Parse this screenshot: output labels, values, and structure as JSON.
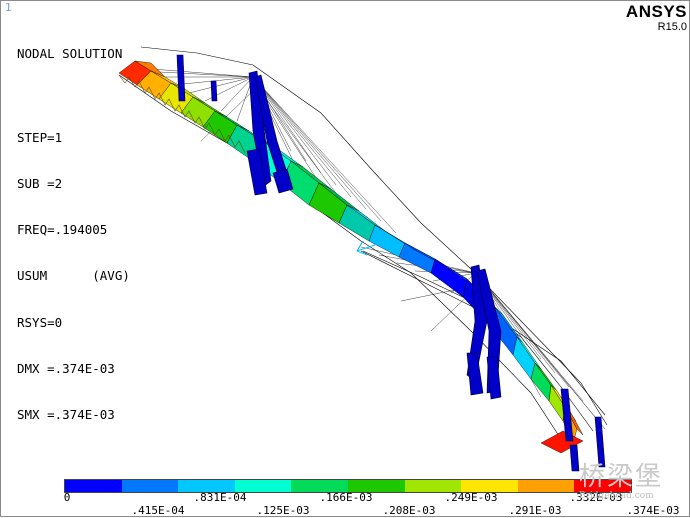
{
  "window": {
    "number": "1"
  },
  "solution_info": {
    "title": "NODAL SOLUTION",
    "lines": [
      "STEP=1",
      "SUB =2",
      "FREQ=.194005",
      "USUM      (AVG)",
      "RSYS=0",
      "DMX =.374E-03",
      "SMX =.374E-03"
    ]
  },
  "logo": {
    "name": "ANSYS",
    "version": "R15.0"
  },
  "legend": {
    "colors": [
      "#0000ff",
      "#0078ff",
      "#00c8ff",
      "#00ffd2",
      "#00dc5a",
      "#1ec800",
      "#a0e600",
      "#ffe600",
      "#ffa000",
      "#ff0000"
    ],
    "top_labels": [
      "0",
      ".831E-04",
      ".166E-03",
      ".249E-03",
      ".332E-03"
    ],
    "bottom_labels": [
      ".415E-04",
      ".125E-03",
      ".208E-03",
      ".291E-03",
      ".374E-03"
    ]
  },
  "watermark": {
    "chinese": "桥梁堡",
    "english": "Bridgehead.com"
  }
}
